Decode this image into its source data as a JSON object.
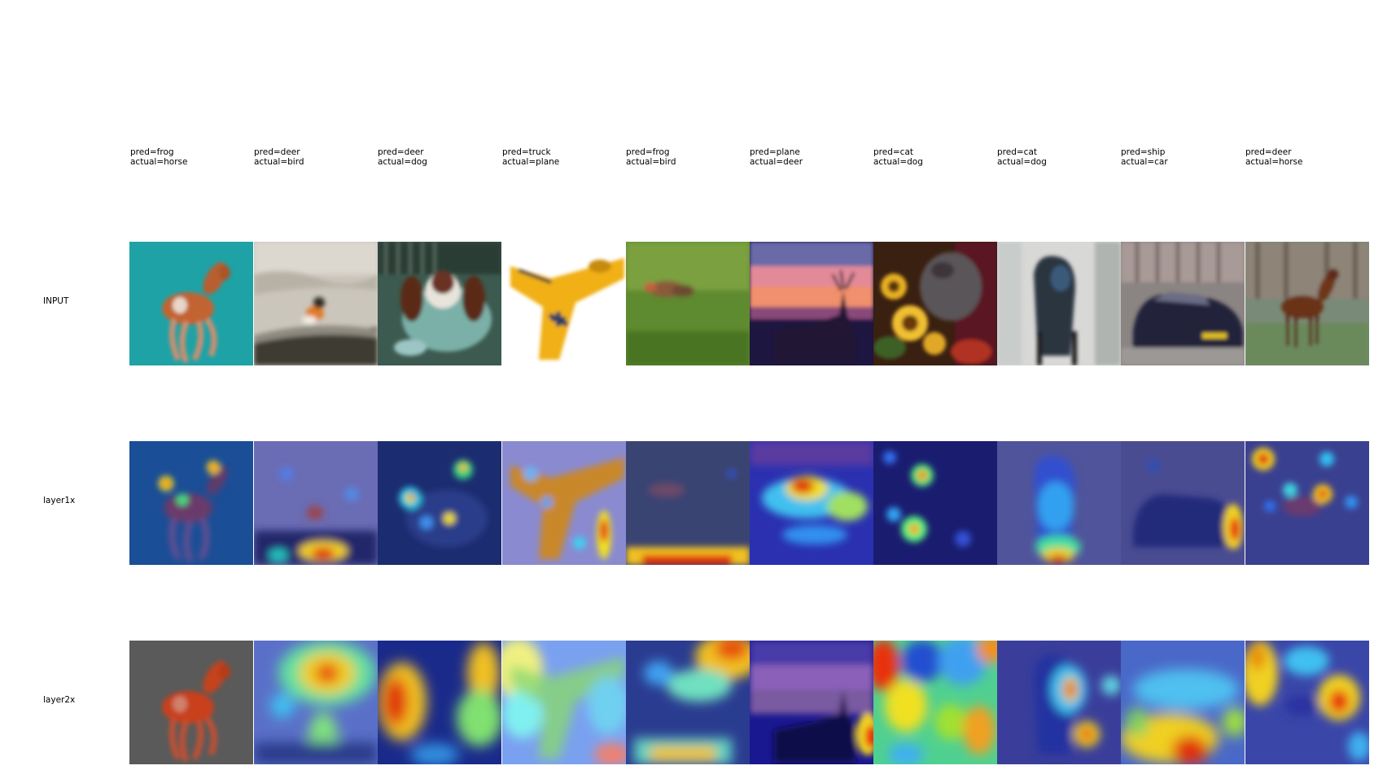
{
  "figure": {
    "row_labels": [
      "INPUT",
      "layer1x",
      "layer2x"
    ],
    "samples": [
      {
        "pred_text": "pred=frog",
        "actual_text": "actual=horse"
      },
      {
        "pred_text": "pred=deer",
        "actual_text": "actual=bird"
      },
      {
        "pred_text": "pred=deer",
        "actual_text": "actual=dog"
      },
      {
        "pred_text": "pred=truck",
        "actual_text": "actual=plane"
      },
      {
        "pred_text": "pred=frog",
        "actual_text": "actual=bird"
      },
      {
        "pred_text": "pred=plane",
        "actual_text": "actual=deer"
      },
      {
        "pred_text": "pred=cat",
        "actual_text": "actual=dog"
      },
      {
        "pred_text": "pred=cat",
        "actual_text": "actual=dog"
      },
      {
        "pred_text": "pred=ship",
        "actual_text": "actual=car"
      },
      {
        "pred_text": "pred=deer",
        "actual_text": "actual=horse"
      }
    ]
  }
}
